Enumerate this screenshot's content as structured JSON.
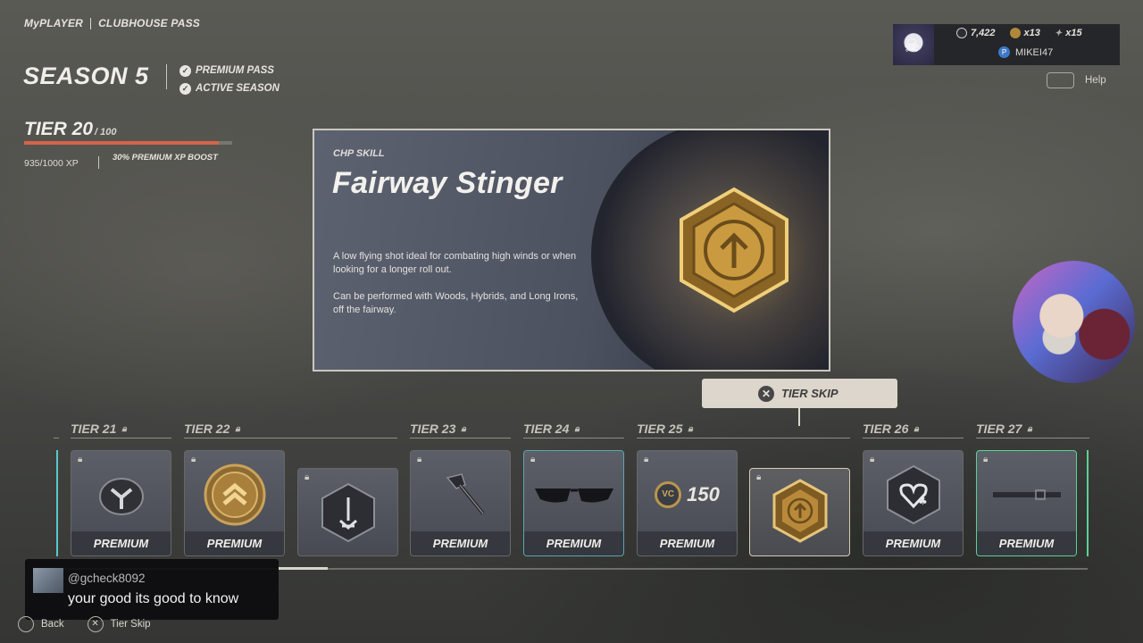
{
  "breadcrumb": [
    "MyPLAYER",
    "CLUBHOUSE PASS"
  ],
  "season": {
    "title": "SEASON 5",
    "flags": [
      "PREMIUM PASS",
      "ACTIVE SEASON"
    ]
  },
  "tier": {
    "label": "TIER 20",
    "max": "/ 100",
    "xp_text": "935/1000 XP",
    "xp_progress": 0.935,
    "boost": "30% PREMIUM XP BOOST",
    "bar_color": "#d5644a"
  },
  "profile": {
    "vc": "7,422",
    "coins": "x13",
    "items": "x15",
    "gamertag": "MIKEI47",
    "help": "Help"
  },
  "featured": {
    "category": "CHP SKILL",
    "title": "Fairway Stinger",
    "description": [
      "A low flying shot ideal for combating high winds or when looking for a longer roll out.",
      "Can be performed with Woods, Hybrids, and Long Irons, off the fairway."
    ]
  },
  "tier_skip": {
    "button_glyph": "✕",
    "label": "TIER SKIP"
  },
  "tiers": [
    {
      "label": "TIER 21"
    },
    {
      "label": "TIER 22"
    },
    {
      "label": "TIER 23"
    },
    {
      "label": "TIER 24"
    },
    {
      "label": "TIER 25"
    },
    {
      "label": "TIER 26"
    },
    {
      "label": "TIER 27"
    }
  ],
  "rewards": [
    {
      "label": "PREMIUM",
      "icon": "golf-glove-icon"
    },
    {
      "label": "PREMIUM",
      "icon": "rank-chevron-medal-icon"
    },
    {
      "label": "",
      "icon": "skill-hexagon-icon"
    },
    {
      "label": "PREMIUM",
      "icon": "golf-club-icon"
    },
    {
      "label": "PREMIUM",
      "icon": "sunglasses-icon"
    },
    {
      "label": "PREMIUM",
      "icon": "vc-currency-icon",
      "amount": "150",
      "currency": "VC"
    },
    {
      "label": "",
      "icon": "fairway-stinger-badge-icon"
    },
    {
      "label": "PREMIUM",
      "icon": "heart-club-skill-icon"
    },
    {
      "label": "PREMIUM",
      "icon": "belt-icon"
    }
  ],
  "chat": {
    "user": "@gcheck8092",
    "message": "your good its good to know"
  },
  "controls": {
    "back": "Back",
    "tier_skip": "Tier Skip"
  },
  "colors": {
    "accent_teal": "#56c9c9",
    "accent_green": "#5fcf98",
    "gold": "#c9a85c"
  }
}
